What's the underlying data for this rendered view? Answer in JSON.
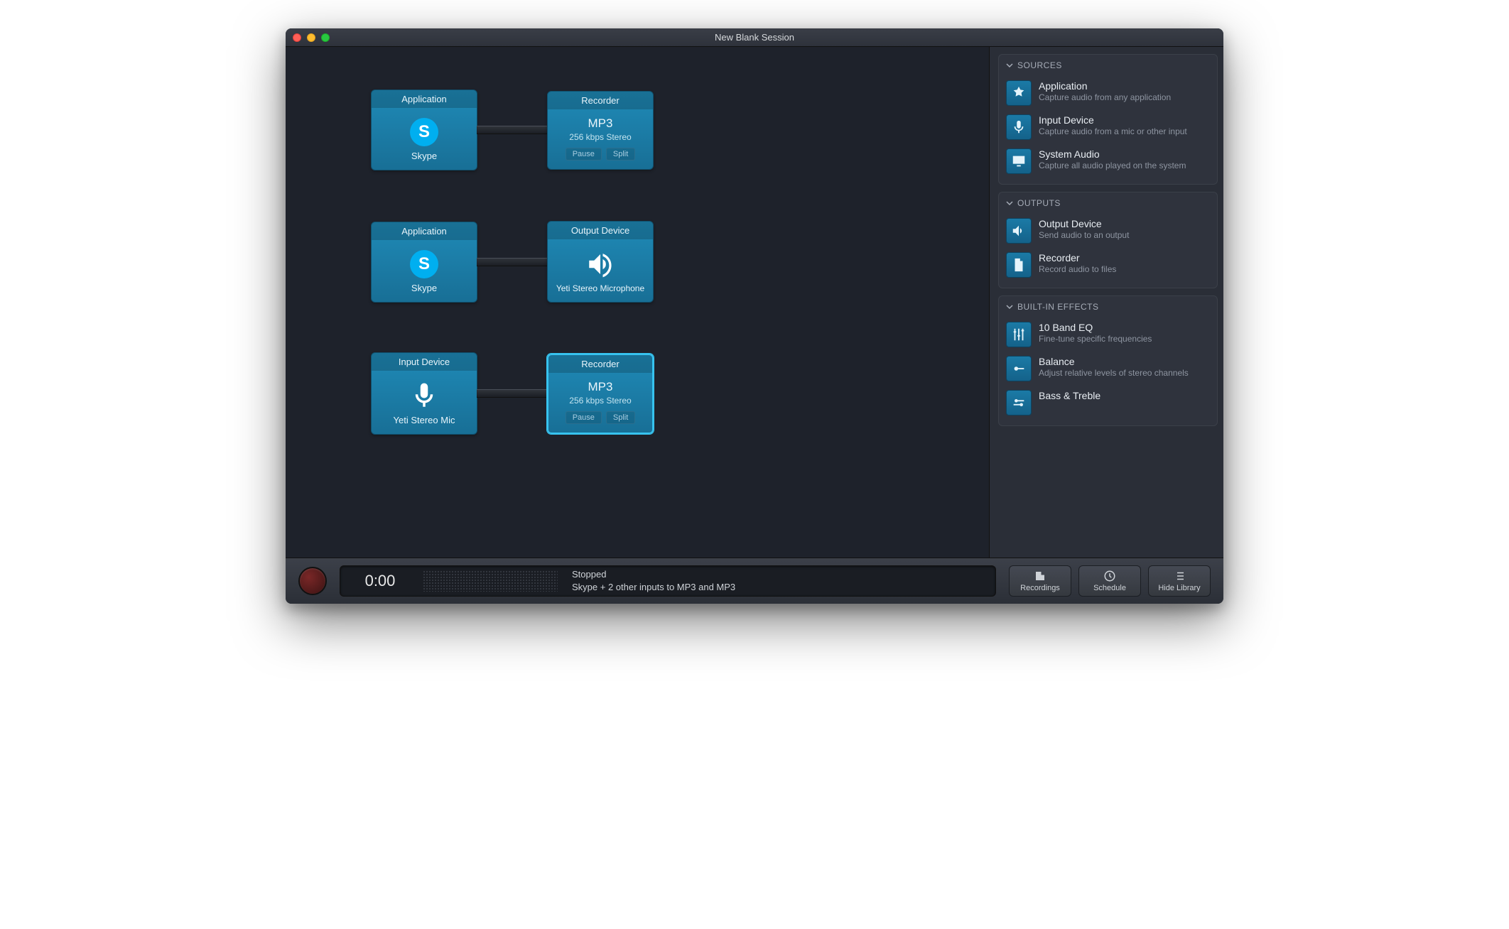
{
  "window": {
    "title": "New Blank Session"
  },
  "chains": [
    {
      "source": {
        "header": "Application",
        "label": "Skype",
        "icon": "skype"
      },
      "dest": {
        "header": "Recorder",
        "big": "MP3",
        "sub": "256 kbps Stereo",
        "btn1": "Pause",
        "btn2": "Split",
        "selected": false
      }
    },
    {
      "source": {
        "header": "Application",
        "label": "Skype",
        "icon": "skype"
      },
      "dest": {
        "header": "Output Device",
        "label": "Yeti Stereo Microphone",
        "icon": "speaker"
      }
    },
    {
      "source": {
        "header": "Input Device",
        "label": "Yeti Stereo Mic",
        "icon": "mic"
      },
      "dest": {
        "header": "Recorder",
        "big": "MP3",
        "sub": "256 kbps Stereo",
        "btn1": "Pause",
        "btn2": "Split",
        "selected": true
      }
    }
  ],
  "sidebar": {
    "sources": {
      "title": "SOURCES",
      "items": [
        {
          "title": "Application",
          "desc": "Capture audio from any application",
          "icon": "appstore"
        },
        {
          "title": "Input Device",
          "desc": "Capture audio from a mic or other input",
          "icon": "mic"
        },
        {
          "title": "System Audio",
          "desc": "Capture all audio played on the system",
          "icon": "display"
        }
      ]
    },
    "outputs": {
      "title": "OUTPUTS",
      "items": [
        {
          "title": "Output Device",
          "desc": "Send audio to an output",
          "icon": "speaker"
        },
        {
          "title": "Recorder",
          "desc": "Record audio to files",
          "icon": "file"
        }
      ]
    },
    "effects": {
      "title": "BUILT-IN EFFECTS",
      "items": [
        {
          "title": "10 Band EQ",
          "desc": "Fine-tune specific frequencies",
          "icon": "sliders"
        },
        {
          "title": "Balance",
          "desc": "Adjust relative levels of stereo channels",
          "icon": "balance"
        },
        {
          "title": "Bass & Treble",
          "desc": "",
          "icon": "balance"
        }
      ]
    }
  },
  "footer": {
    "time": "0:00",
    "status1": "Stopped",
    "status2": "Skype + 2 other inputs to MP3 and MP3",
    "buttons": {
      "recordings": "Recordings",
      "schedule": "Schedule",
      "hide": "Hide Library"
    }
  }
}
